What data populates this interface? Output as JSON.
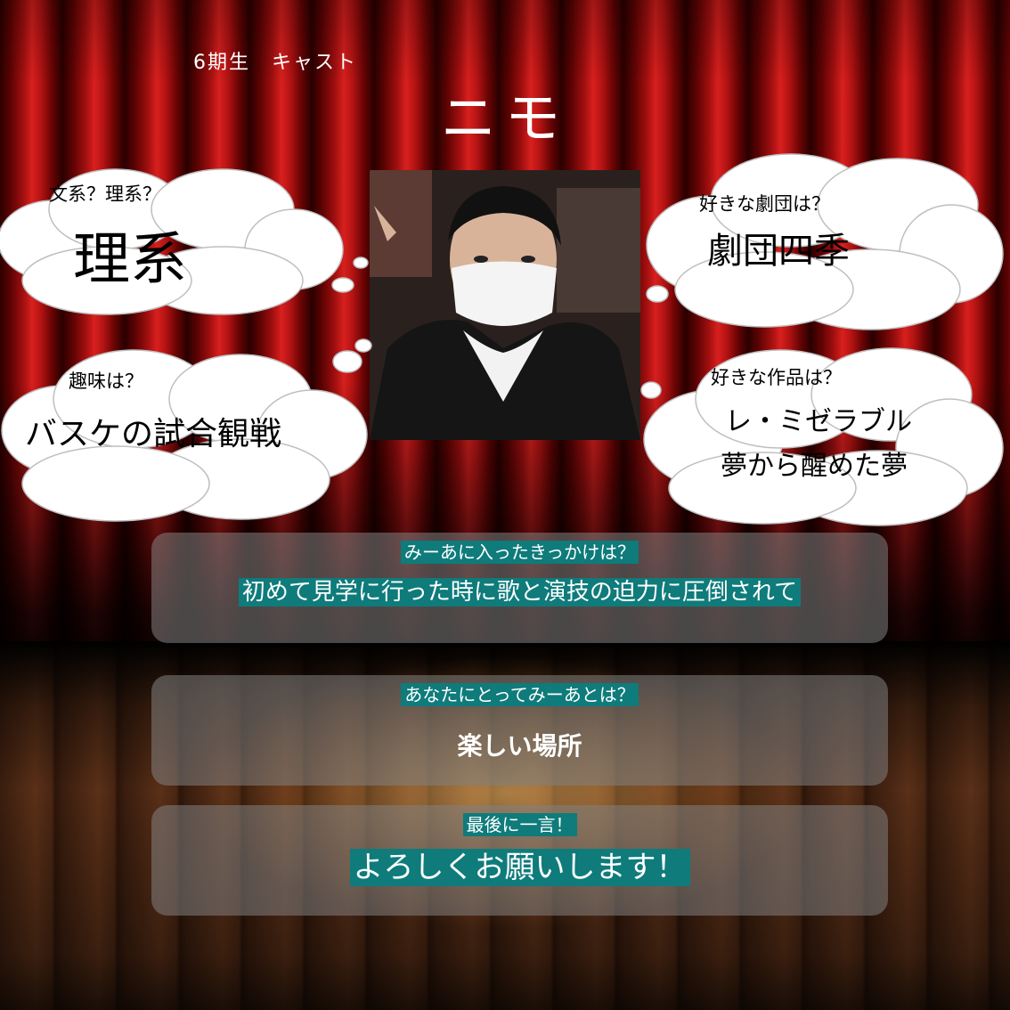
{
  "header": {
    "cast_label": "6期生　キャスト",
    "name": "ニモ"
  },
  "profile": {
    "photo_alt": "",
    "faculty_question": "文系？理系？",
    "faculty_answer": "理系",
    "hobby_question": "趣味は？",
    "hobby_answer": "バスケの試合観戦",
    "troupe_question": "好きな劇団は？",
    "troupe_answer": "劇団四季",
    "works_question": "好きな作品は？",
    "works_answer_1": "レ・ミゼラブル",
    "works_answer_2": "夢から醒めた夢"
  },
  "panels": {
    "reason_question": "みーあに入ったきっかけは？",
    "reason_answer": "初めて見学に行った時に歌と演技の迫力に圧倒されて",
    "meaning_question": "あなたにとってみーあとは？",
    "meaning_answer": "楽しい場所",
    "message_question": "最後に一言！",
    "message_answer": "よろしくお願いします！"
  },
  "colors": {
    "highlight": "#0f7b7b",
    "curtain": "#b31313",
    "cloud": "#ffffff"
  }
}
